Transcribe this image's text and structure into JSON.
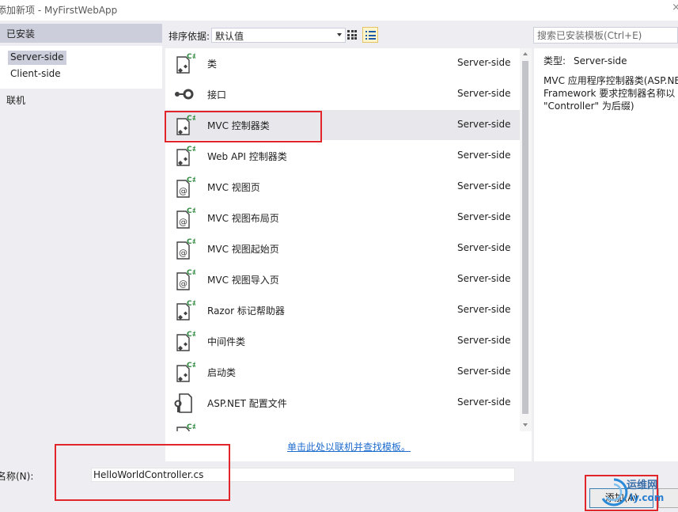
{
  "window": {
    "title": "添加新项 - MyFirstWebApp"
  },
  "left_pane": {
    "header": "已安装",
    "items": [
      "Server-side",
      "Client-side"
    ],
    "online": "联机"
  },
  "toolbar": {
    "sort_label": "排序依据:",
    "sort_value": "默认值"
  },
  "search": {
    "placeholder": "搜索已安装模板(Ctrl+E)"
  },
  "templates": [
    {
      "name": "类",
      "category": "Server-side",
      "icon": "csharp-class-icon"
    },
    {
      "name": "接口",
      "category": "Server-side",
      "icon": "interface-icon"
    },
    {
      "name": "MVC 控制器类",
      "category": "Server-side",
      "icon": "csharp-class-icon"
    },
    {
      "name": "Web API 控制器类",
      "category": "Server-side",
      "icon": "csharp-class-icon"
    },
    {
      "name": "MVC 视图页",
      "category": "Server-side",
      "icon": "razor-page-icon"
    },
    {
      "name": "MVC 视图布局页",
      "category": "Server-side",
      "icon": "razor-page-icon"
    },
    {
      "name": "MVC 视图起始页",
      "category": "Server-side",
      "icon": "razor-page-icon"
    },
    {
      "name": "MVC 视图导入页",
      "category": "Server-side",
      "icon": "razor-page-icon"
    },
    {
      "name": "Razor 标记帮助器",
      "category": "Server-side",
      "icon": "csharp-class-icon"
    },
    {
      "name": "中间件类",
      "category": "Server-side",
      "icon": "csharp-class-icon"
    },
    {
      "name": "启动类",
      "category": "Server-side",
      "icon": "csharp-class-icon"
    },
    {
      "name": "ASP.NET 配置文件",
      "category": "Server-side",
      "icon": "config-file-icon"
    }
  ],
  "selected_template_index": 2,
  "online_link": "单击此处以联机并查找模板。",
  "details": {
    "type_label": "类型:",
    "type_value": "Server-side",
    "description": "MVC 应用程序控制器类(ASP.NE\nFramework 要求控制器名称以\n\"Controller\" 为后缀)"
  },
  "bottom": {
    "name_label": "名称(N):",
    "name_value": "HelloWorldController.cs",
    "add_button": "添加(A)"
  },
  "watermark": {
    "line1": "运维网",
    "line2": "iy.com"
  },
  "colors": {
    "selection": "#e8e8ec",
    "link": "#1e6ccd",
    "annotation": "#e0252b",
    "csharp_badge": "#2f8a3e"
  }
}
